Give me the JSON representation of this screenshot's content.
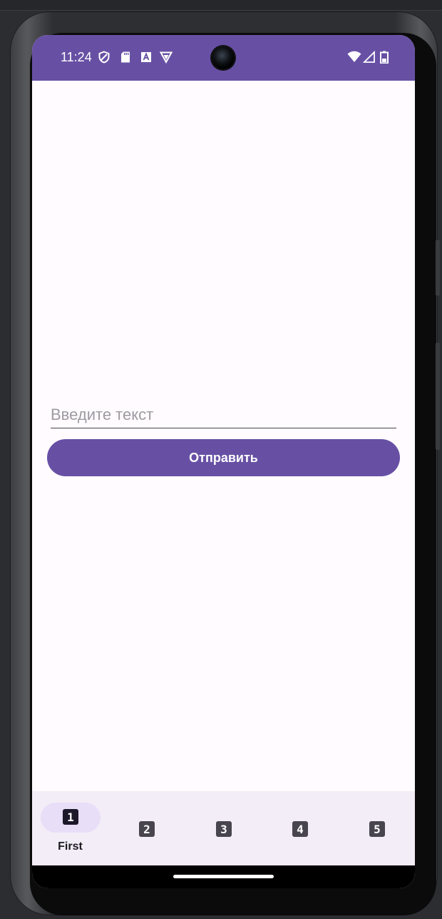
{
  "status_bar": {
    "time": "11:24",
    "left_icons": [
      "shield-icon",
      "sd-card-icon",
      "font-a-icon",
      "vpn-triangle-icon"
    ],
    "right_icons": [
      "wifi-icon",
      "cell-signal-icon",
      "battery-icon"
    ]
  },
  "form": {
    "input_value": "",
    "input_placeholder": "Введите текст",
    "submit_label": "Отправить"
  },
  "bottom_nav": {
    "items": [
      {
        "number": "1",
        "label": "First",
        "active": true
      },
      {
        "number": "2",
        "label": "",
        "active": false
      },
      {
        "number": "3",
        "label": "",
        "active": false
      },
      {
        "number": "4",
        "label": "",
        "active": false
      },
      {
        "number": "5",
        "label": "",
        "active": false
      }
    ]
  },
  "colors": {
    "primary": "#6750a4",
    "surface": "#fffbfe",
    "nav_surface": "#f3edf7",
    "active_indicator": "#e8def8"
  }
}
